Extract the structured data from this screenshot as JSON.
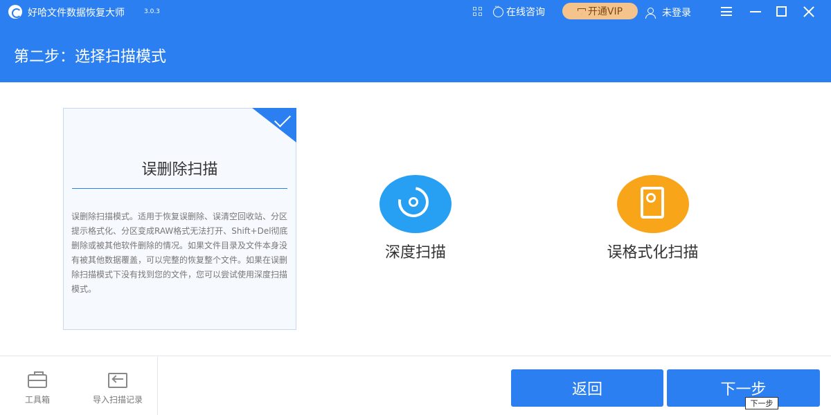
{
  "titlebar": {
    "app_name": "好哈文件数据恢复大师",
    "version": "3.0.3",
    "consult_label": "在线咨询",
    "vip_label": "开通VIP",
    "login_label": "未登录"
  },
  "step": {
    "title": "第二步：选择扫描模式"
  },
  "modes": {
    "selected": {
      "title": "误删除扫描",
      "description": "误删除扫描模式。适用于恢复误删除、误清空回收站、分区提示格式化、分区变成RAW格式无法打开、Shift+Del彻底删除或被其他软件删除的情况。如果文件目录及文件本身没有被其他数据覆盖，可以完整的恢复整个文件。如果在误删除扫描模式下没有找到您的文件，您可以尝试使用深度扫描模式。"
    },
    "deep": {
      "label": "深度扫描",
      "icon": "deep-scan-icon",
      "color": "#27a0f3"
    },
    "format": {
      "label": "误格式化扫描",
      "icon": "format-scan-icon",
      "color": "#f9a51a"
    }
  },
  "footer": {
    "toolbox_label": "工具箱",
    "import_label": "导入扫描记录",
    "back_label": "返回",
    "next_label": "下一步",
    "tooltip": "下一步"
  },
  "colors": {
    "primary": "#2b7ff0",
    "vip": "#f4c48c"
  }
}
